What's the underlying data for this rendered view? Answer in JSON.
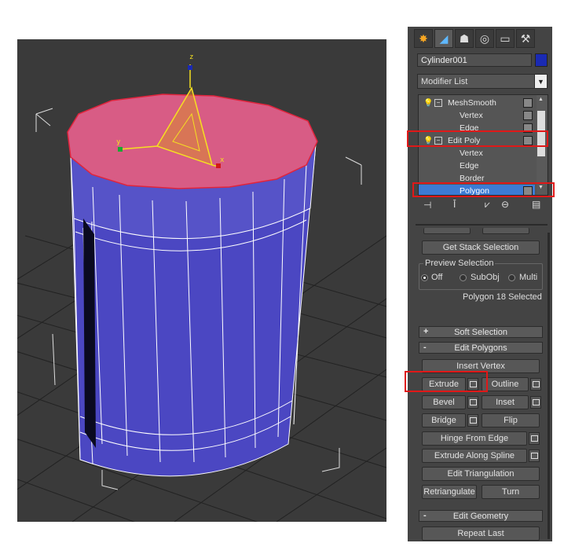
{
  "viewport": {
    "gizmo_axes": {
      "x": "x",
      "y": "y",
      "z": "z"
    }
  },
  "panel": {
    "object_name": "Cylinder001",
    "object_color": "#1a2ab3",
    "modifier_list_label": "Modifier List",
    "stack": [
      {
        "label": "MeshSmooth",
        "level": 0
      },
      {
        "label": "Vertex",
        "level": 1
      },
      {
        "label": "Edge",
        "level": 1
      },
      {
        "label": "Edit Poly",
        "level": 0
      },
      {
        "label": "Vertex",
        "level": 1
      },
      {
        "label": "Edge",
        "level": 1
      },
      {
        "label": "Border",
        "level": 1
      },
      {
        "label": "Polygon",
        "level": 1
      }
    ],
    "get_stack_selection": "Get Stack Selection",
    "preview_selection": {
      "title": "Preview Selection",
      "options": [
        "Off",
        "SubObj",
        "Multi"
      ],
      "selected": "Off"
    },
    "selection_status": "Polygon 18 Selected",
    "soft_selection": {
      "symbol": "+",
      "label": "Soft Selection"
    },
    "edit_polygons": {
      "symbol": "-",
      "label": "Edit Polygons"
    },
    "buttons": {
      "insert_vertex": "Insert Vertex",
      "extrude": "Extrude",
      "outline": "Outline",
      "bevel": "Bevel",
      "inset": "Inset",
      "bridge": "Bridge",
      "flip": "Flip",
      "hinge_from_edge": "Hinge From Edge",
      "extrude_along_spline": "Extrude Along Spline",
      "edit_triangulation": "Edit Triangulation",
      "retriangulate": "Retriangulate",
      "turn": "Turn"
    },
    "edit_geometry": {
      "symbol": "-",
      "label": "Edit Geometry"
    },
    "repeat_last": "Repeat Last"
  },
  "colors": {
    "top_face": "#d85c85",
    "body_face": "#4b47c2",
    "highlight": "#e01818",
    "selection_blue": "#3c7bd4"
  }
}
